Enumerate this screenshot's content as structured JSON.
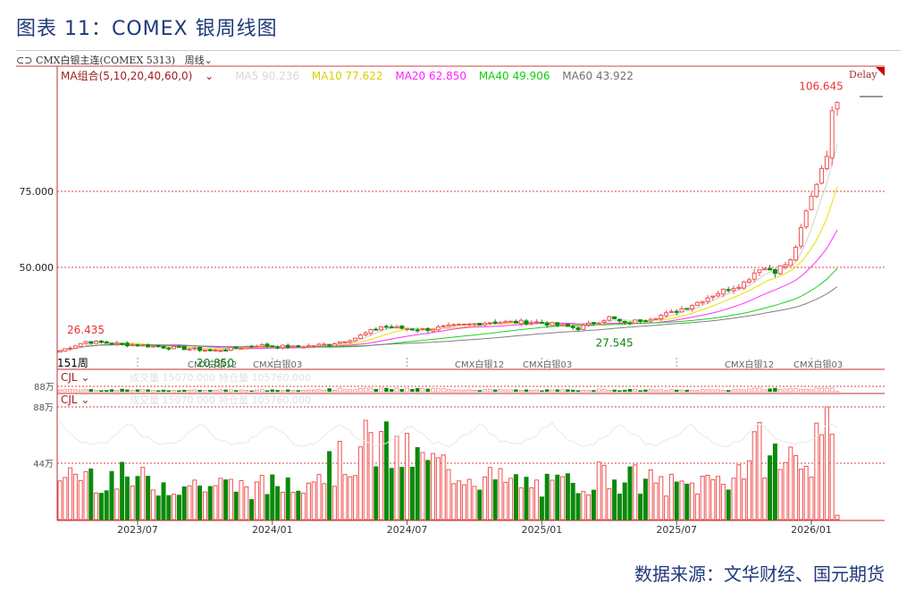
{
  "title": "图表 11：COMEX 银周线图",
  "header": {
    "instrument": "CMX白银主连(COMEX 5313)",
    "period": "周线"
  },
  "ma_legend": {
    "group": "MA组合(5,10,20,40,60,0)",
    "ma5": "MA5 90.236",
    "ma10": "MA10 77.622",
    "ma20": "MA20 62.850",
    "ma40": "MA40 49.906",
    "ma60": "MA60 43.922"
  },
  "delay": "Delay",
  "bar_count": "151周",
  "contract_labels": [
    "CMX白银12",
    "CMX白银03",
    "CMX白银12",
    "CMX白银03",
    "CMX白银12",
    "CMX白银03"
  ],
  "volume_panel": {
    "name": "CJL",
    "volume_text": "成交量 15070.000",
    "oi_text": "持仓量 105760.000",
    "mini_tick": "88万"
  },
  "colors": {
    "up": "#f05050",
    "down": "#0a8a0a",
    "ma5": "#d0d0d0",
    "ma10": "#e8e000",
    "ma20": "#ff30ff",
    "ma40": "#20d020",
    "ma60": "#808080",
    "grid": "#e04040"
  },
  "footer": "数据来源：文华财经、国元期货",
  "chart_data": {
    "type": "candlestick",
    "bars": 151,
    "yticks": [
      "75.000",
      "50.000"
    ],
    "ytick_values": [
      75,
      50
    ],
    "vol_ticks": [
      "88万",
      "44万"
    ],
    "vol_tick_values": [
      88,
      44
    ],
    "xticks": [
      "2023/07",
      "2024/01",
      "2024/07",
      "2025/01",
      "2025/07",
      "2026/01"
    ],
    "xtick_index": [
      15,
      41,
      67,
      93,
      119,
      145
    ],
    "annotations": [
      {
        "text": "26.435",
        "index": 5,
        "value": 26.435,
        "kind": "high"
      },
      {
        "text": "20.850",
        "index": 30,
        "value": 20.85,
        "kind": "low"
      },
      {
        "text": "27.545",
        "index": 107,
        "value": 27.545,
        "kind": "low"
      },
      {
        "text": "106.645",
        "index": 150,
        "value": 106.645,
        "kind": "high"
      }
    ],
    "close_anchors": [
      [
        0,
        22.6
      ],
      [
        5,
        25.6
      ],
      [
        15,
        24.4
      ],
      [
        30,
        22.6
      ],
      [
        38,
        24.4
      ],
      [
        45,
        23.8
      ],
      [
        52,
        24.7
      ],
      [
        57,
        26.8
      ],
      [
        62,
        30.5
      ],
      [
        70,
        29.5
      ],
      [
        83,
        32
      ],
      [
        92,
        32
      ],
      [
        100,
        30
      ],
      [
        106,
        33.5
      ],
      [
        109,
        31.5
      ],
      [
        118,
        35
      ],
      [
        123,
        38.5
      ],
      [
        126,
        41
      ],
      [
        132,
        45
      ],
      [
        135,
        50
      ],
      [
        138,
        49
      ],
      [
        141,
        52
      ],
      [
        143,
        62
      ],
      [
        144,
        68
      ],
      [
        146,
        78
      ],
      [
        148,
        88
      ],
      [
        149,
        100
      ],
      [
        150,
        106
      ]
    ],
    "volume_anchors_wan": [
      [
        0,
        38
      ],
      [
        20,
        28
      ],
      [
        40,
        25
      ],
      [
        55,
        45
      ],
      [
        60,
        60
      ],
      [
        70,
        45
      ],
      [
        85,
        30
      ],
      [
        95,
        25
      ],
      [
        105,
        35
      ],
      [
        120,
        25
      ],
      [
        130,
        35
      ],
      [
        135,
        55
      ],
      [
        140,
        45
      ],
      [
        146,
        55
      ],
      [
        148,
        80
      ],
      [
        149,
        50
      ],
      [
        150,
        3
      ]
    ]
  }
}
